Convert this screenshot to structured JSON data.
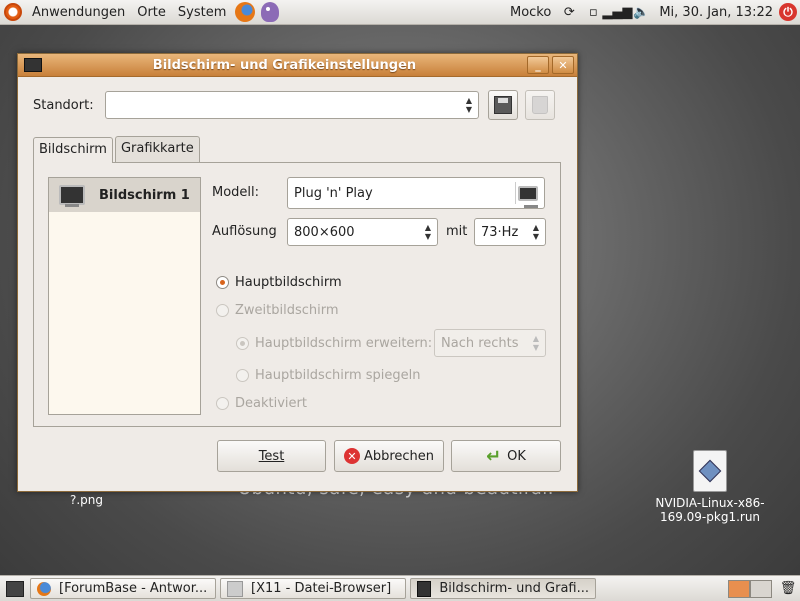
{
  "top_panel": {
    "menu_applications": "Anwendungen",
    "menu_places": "Orte",
    "menu_system": "System",
    "user": "Mocko",
    "clock": "Mi, 30. Jan, 13:22"
  },
  "desktop": {
    "wallpaper_text": "Ubuntu, safe, easy and beautiful.",
    "file_label_png": "?.png",
    "file_nvidia": "NVIDIA-Linux-x86-169.09-pkg1.run"
  },
  "dialog": {
    "title": "Bildschirm- und Grafikeinstellungen",
    "standort_label": "Standort:",
    "standort_value": "",
    "tabs": [
      "Bildschirm",
      "Grafikkarte"
    ],
    "screen_list": [
      "Bildschirm 1"
    ],
    "model_label": "Modell:",
    "model_value": "Plug 'n' Play",
    "resolution_label": "Auflösung",
    "resolution_value": "800×600",
    "mit_label": "mit",
    "refresh_value": "73·Hz",
    "radio_primary": "Hauptbildschirm",
    "radio_secondary": "Zweitbildschirm",
    "radio_extend": "Hauptbildschirm erweitern:",
    "extend_direction": "Nach rechts",
    "radio_mirror": "Hauptbildschirm spiegeln",
    "radio_disabled": "Deaktiviert",
    "btn_test": "Test",
    "btn_cancel": "Abbrechen",
    "btn_ok": "OK"
  },
  "taskbar": {
    "tasks": [
      "[ForumBase - Antwor...",
      "[X11 - Datei-Browser]",
      "Bildschirm- und Grafi..."
    ]
  },
  "colors": {
    "titlebar": "#c8803a",
    "accent": "#d8641c"
  }
}
